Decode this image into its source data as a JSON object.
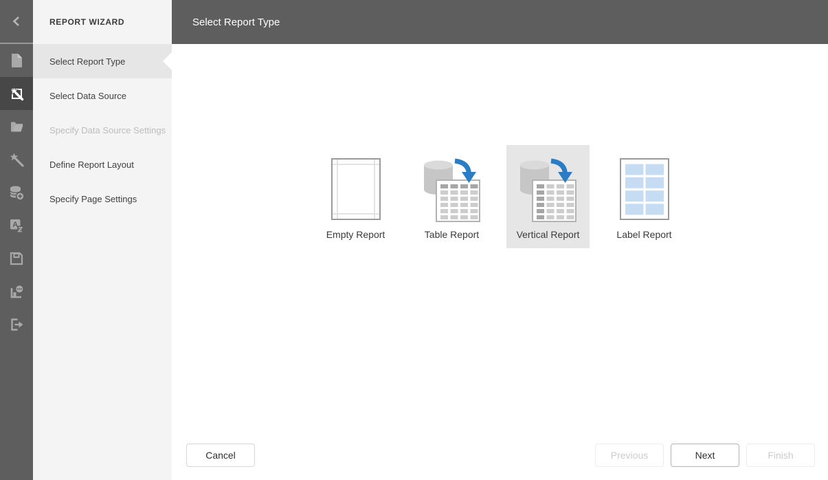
{
  "colors": {
    "rail_bg": "#5e5e5e",
    "rail_active_bg": "#474747",
    "rail_icon": "#a8a8a8",
    "rail_icon_active": "#ffffff",
    "sidebar_bg": "#f4f4f4",
    "selected_bg": "#e6e6e6",
    "header_bg": "#5e5e5e",
    "header_text": "#ffffff",
    "text": "#3a3a3a",
    "disabled_text": "#bcbcbc",
    "accent_blue": "#2a7dc4",
    "label_cell_blue": "#c5dcf2",
    "icon_gray": "#c6c6c6"
  },
  "icon_rail": {
    "items": [
      {
        "icon": "collapse-panel-icon",
        "active": false
      },
      {
        "icon": "new-report-icon",
        "active": false
      },
      {
        "icon": "report-wizard-icon",
        "active": true
      },
      {
        "icon": "open-report-icon",
        "active": false
      },
      {
        "icon": "design-wizard-icon",
        "active": false
      },
      {
        "icon": "add-data-source-icon",
        "active": false
      },
      {
        "icon": "localization-icon",
        "active": false
      },
      {
        "icon": "save-icon",
        "active": false
      },
      {
        "icon": "preview-icon",
        "active": false
      },
      {
        "icon": "exit-icon",
        "active": false
      }
    ]
  },
  "sidebar": {
    "title": "REPORT WIZARD",
    "items": [
      {
        "label": "Select Report Type",
        "state": "selected"
      },
      {
        "label": "Select Data Source",
        "state": "enabled"
      },
      {
        "label": "Specify Data Source Settings",
        "state": "disabled"
      },
      {
        "label": "Define Report Layout",
        "state": "enabled"
      },
      {
        "label": "Specify Page Settings",
        "state": "enabled"
      }
    ]
  },
  "header": {
    "title": "Select Report Type"
  },
  "report_types": {
    "options": [
      {
        "label": "Empty Report",
        "icon": "empty-report-icon",
        "selected": false
      },
      {
        "label": "Table Report",
        "icon": "table-report-icon",
        "selected": false
      },
      {
        "label": "Vertical Report",
        "icon": "vertical-report-icon",
        "selected": true
      },
      {
        "label": "Label Report",
        "icon": "label-report-icon",
        "selected": false
      }
    ]
  },
  "footer": {
    "cancel": "Cancel",
    "previous": "Previous",
    "next": "Next",
    "finish": "Finish"
  }
}
